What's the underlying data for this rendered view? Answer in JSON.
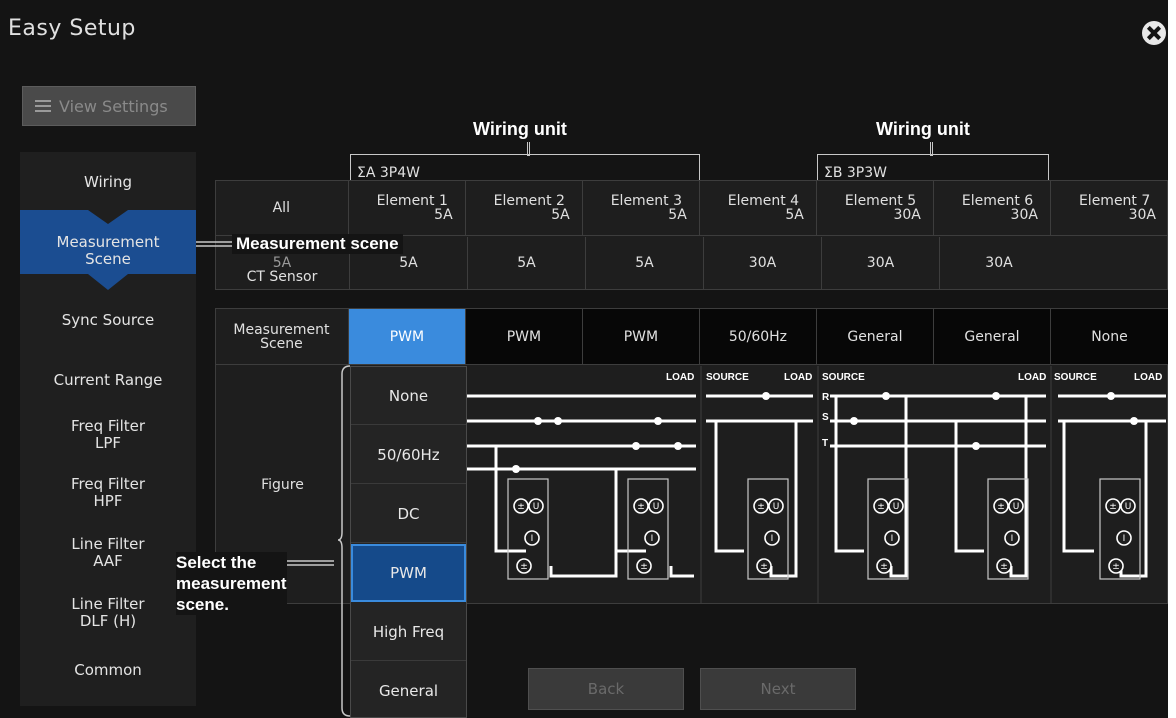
{
  "window": {
    "title": "Easy Setup"
  },
  "toolbar": {
    "view_settings_label": "View Settings"
  },
  "sidebar": {
    "items": [
      {
        "label": "Wiring"
      },
      {
        "label": "Measurement\nScene"
      },
      {
        "label": "Sync Source"
      },
      {
        "label": "Current Range"
      },
      {
        "label": "Freq Filter\nLPF"
      },
      {
        "label": "Freq Filter\nHPF"
      },
      {
        "label": "Line Filter\nAAF"
      },
      {
        "label": "Line Filter\nDLF (H)"
      },
      {
        "label": "Common"
      }
    ]
  },
  "annotations": {
    "wiring_unit_1": "Wiring unit",
    "wiring_unit_2": "Wiring unit",
    "measurement_scene": "Measurement scene",
    "select_scene": "Select the\nmeasurement\nscene."
  },
  "wiring_units": [
    {
      "label": "ΣA  3P4W"
    },
    {
      "label": "ΣB  3P3W"
    }
  ],
  "elements_header": {
    "all_label": "All",
    "elements": [
      {
        "name": "Element 1",
        "range": "5A"
      },
      {
        "name": "Element 2",
        "range": "5A"
      },
      {
        "name": "Element 3",
        "range": "5A"
      },
      {
        "name": "Element 4",
        "range": "5A"
      },
      {
        "name": "Element 5",
        "range": "30A"
      },
      {
        "name": "Element 6",
        "range": "30A"
      },
      {
        "name": "Element 7",
        "range": "30A"
      }
    ]
  },
  "ct_row": {
    "label": "CT Sensor",
    "all_value": "5A",
    "values": [
      "5A",
      "5A",
      "5A",
      "30A",
      "30A",
      "30A"
    ]
  },
  "scene_row": {
    "label": "Measurement\nScene",
    "values": [
      "PWM",
      "PWM",
      "PWM",
      "50/60Hz",
      "General",
      "General",
      "None"
    ]
  },
  "figure": {
    "label": "Figure",
    "load_label": "LOAD",
    "source_label": "SOURCE",
    "phase_r": "R",
    "phase_s": "S",
    "phase_t": "T",
    "meter_u": "U",
    "meter_i": "I",
    "meter_pm": "±"
  },
  "dropdown": {
    "options": [
      "None",
      "50/60Hz",
      "DC",
      "PWM",
      "High Freq",
      "General"
    ],
    "selected": "PWM"
  },
  "footer": {
    "back_label": "Back",
    "next_label": "Next"
  },
  "colors": {
    "accent_blue": "#3a8bdd",
    "active_nav": "#1b4d91",
    "background": "#141414"
  }
}
